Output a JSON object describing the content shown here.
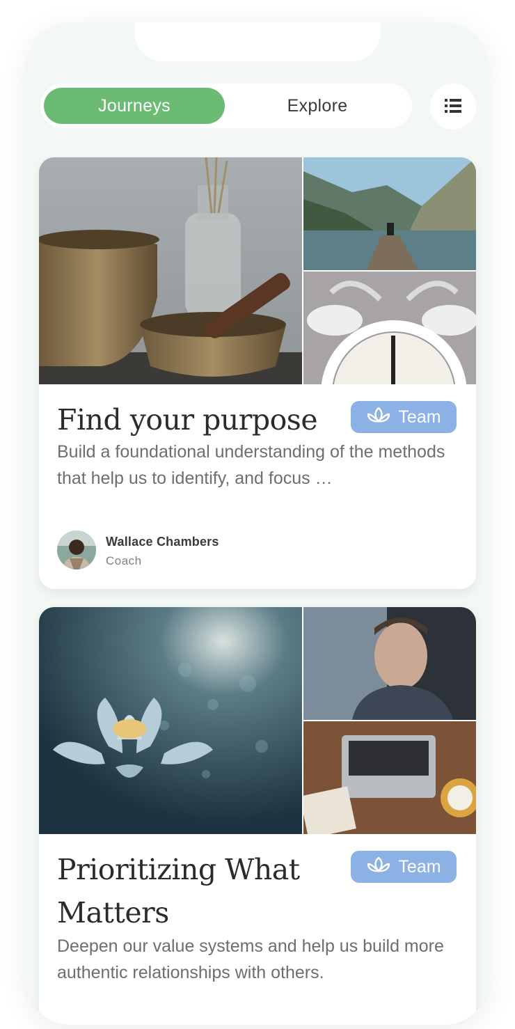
{
  "tabs": {
    "active_label": "Journeys",
    "inactive_label": "Explore"
  },
  "menu": {
    "icon": "list-icon"
  },
  "journeys": [
    {
      "title": "Find your purpose",
      "badge": "Team",
      "badge_icon": "lotus-icon",
      "description": "Build a foundational understanding of the methods that help us to identify, and focus …",
      "author_name": "Wallace Chambers",
      "author_role": "Coach",
      "images": [
        "singing-bowls-photo",
        "mountain-lake-photo",
        "alarm-clock-photo"
      ]
    },
    {
      "title": "Prioritizing What Matters",
      "badge": "Team",
      "badge_icon": "lotus-icon",
      "description": "Deepen our value systems and help us build more authentic relationships with others.",
      "images": [
        "lotus-flower-photo",
        "man-portrait-photo",
        "laptop-desk-photo"
      ]
    }
  ],
  "colors": {
    "accent_green": "#6cbb74",
    "badge_blue": "#8cb1e4",
    "background": "#f3f8f5"
  }
}
